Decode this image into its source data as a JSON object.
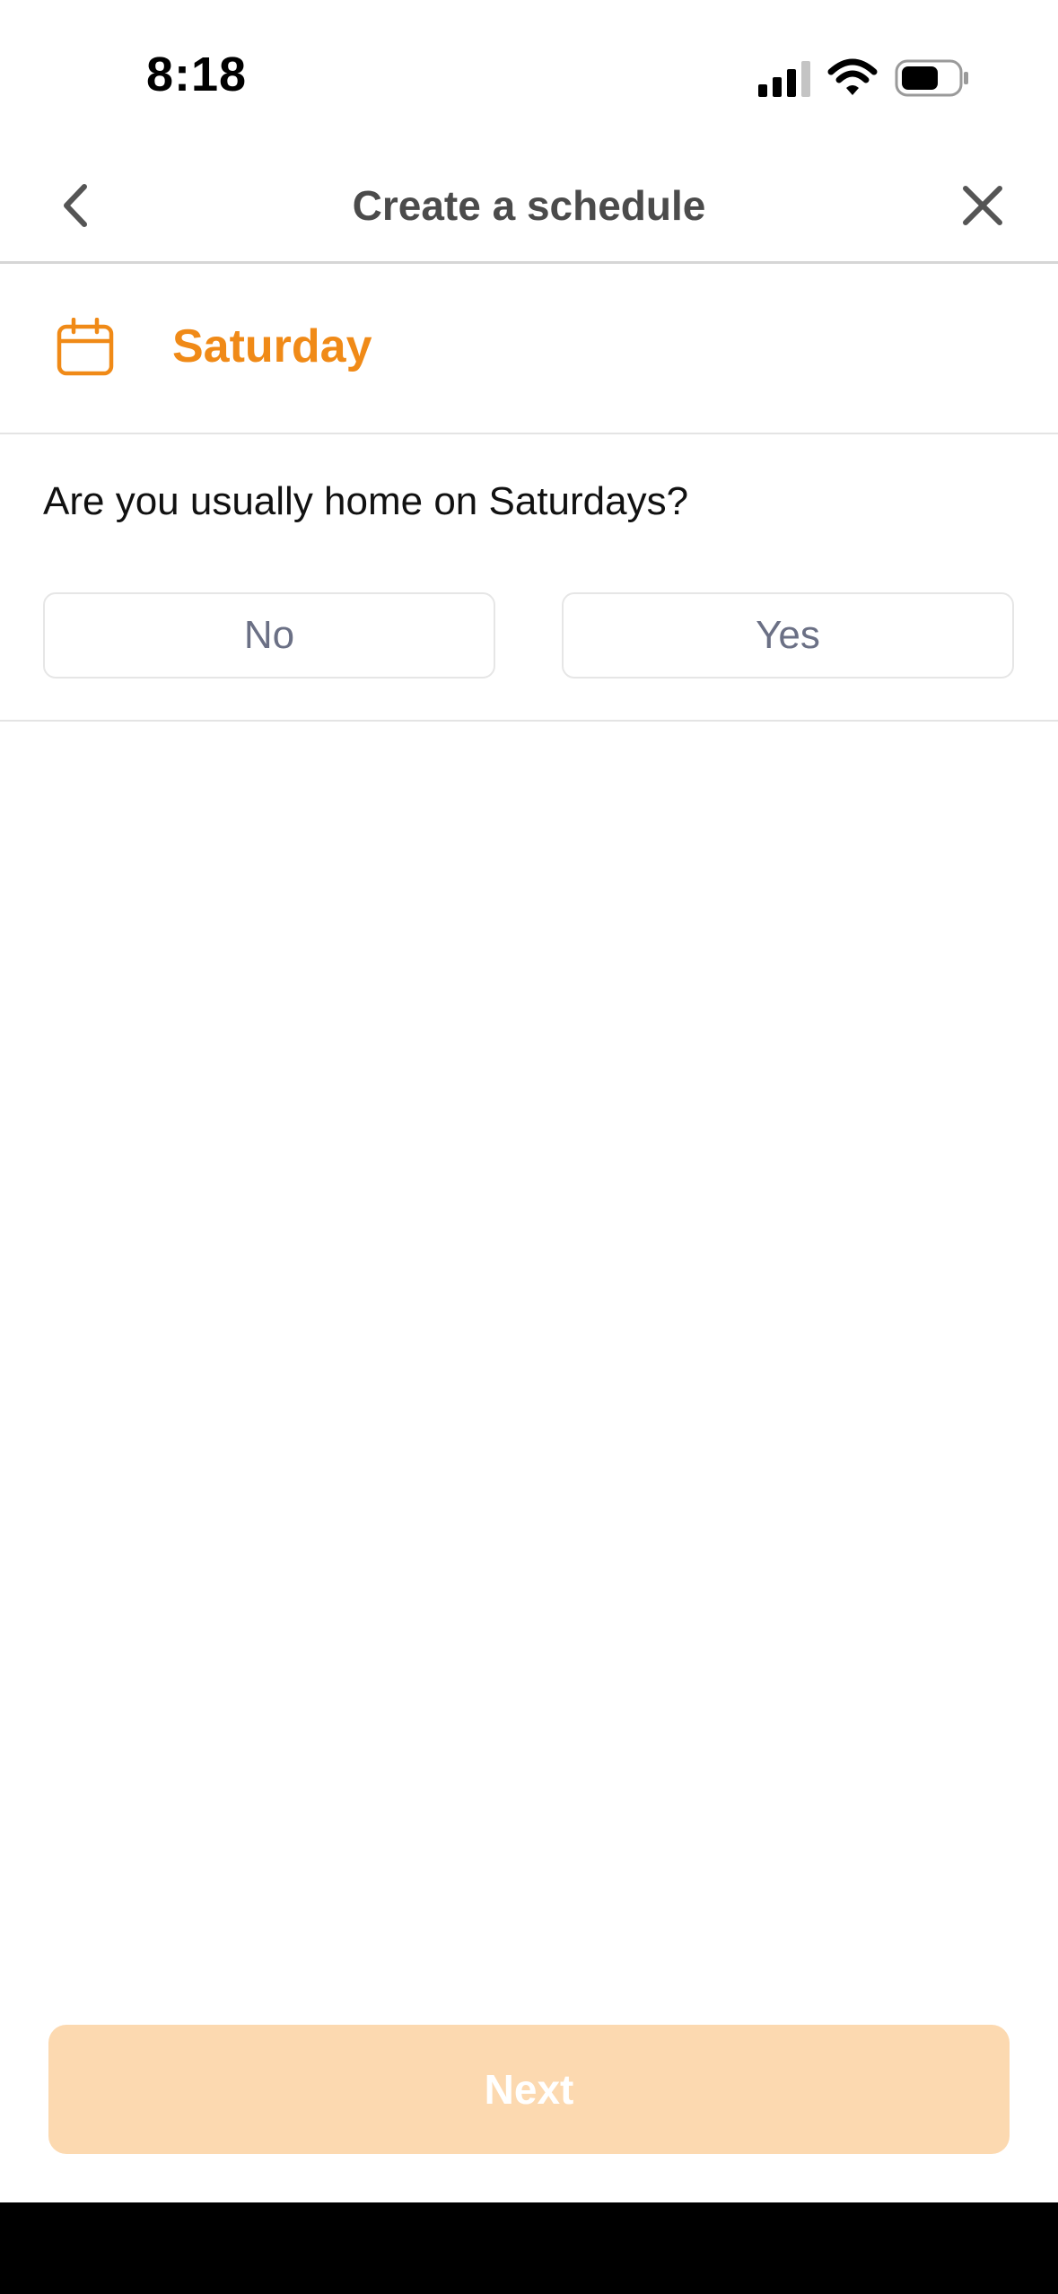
{
  "status_bar": {
    "time": "8:18",
    "icons": [
      "signal-icon",
      "wifi-icon",
      "battery-icon"
    ]
  },
  "header": {
    "title": "Create a schedule",
    "back_icon": "chevron-left-icon",
    "close_icon": "close-icon"
  },
  "day": {
    "icon": "calendar-icon",
    "label": "Saturday",
    "color": "#f08a17"
  },
  "question": {
    "text": "Are you usually home on Saturdays?",
    "options": [
      "No",
      "Yes"
    ]
  },
  "footer": {
    "next_label": "Next",
    "next_color": "#fcd9b0"
  }
}
